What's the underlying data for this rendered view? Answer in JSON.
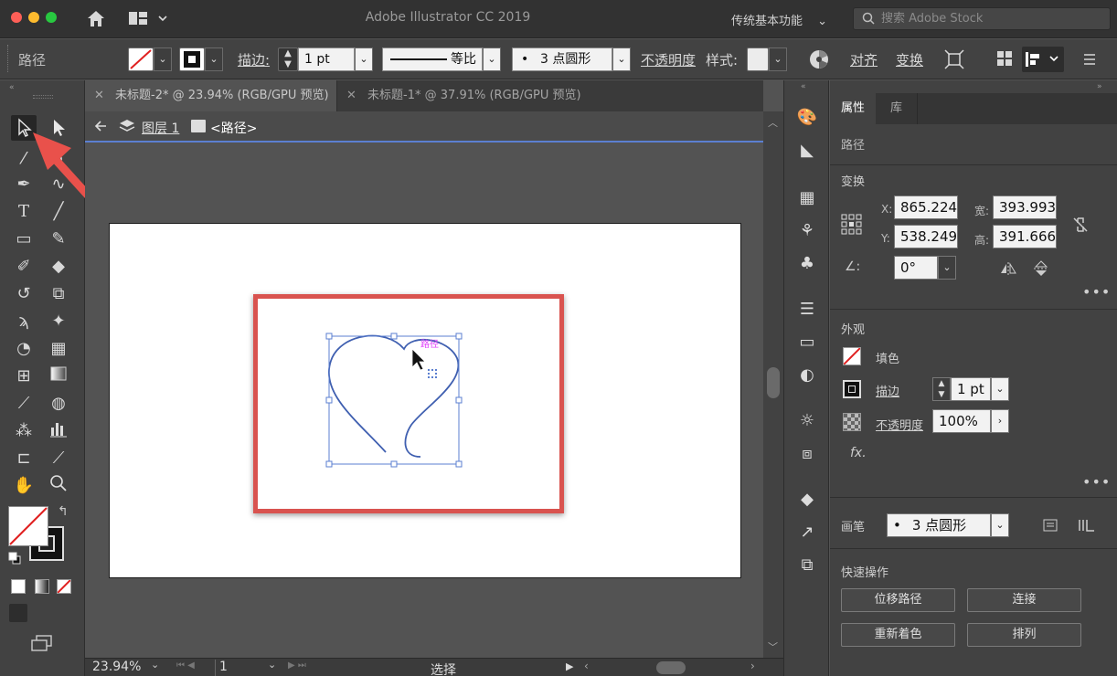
{
  "window": {
    "title": "Adobe Illustrator CC 2019",
    "workspace": "传统基本功能",
    "stock_search_placeholder": "搜索 Adobe Stock"
  },
  "control_bar": {
    "selection_type": "路径",
    "stroke_label": "描边:",
    "stroke_weight": "1 pt",
    "stroke_profile": "等比",
    "brush": "3 点圆形",
    "opacity_label": "不透明度",
    "style_label": "样式:",
    "align_label": "对齐",
    "transform_label": "变换"
  },
  "document_tabs": [
    {
      "label": "未标题-2* @ 23.94% (RGB/GPU 预览)",
      "active": true
    },
    {
      "label": "未标题-1* @ 37.91% (RGB/GPU 预览)",
      "active": false
    }
  ],
  "breadcrumb": {
    "layer": "图层 1",
    "object": "<路径>"
  },
  "canvas": {
    "path_hint": "路径"
  },
  "status_bar": {
    "zoom": "23.94%",
    "artboard_number": "1",
    "tool_status": "选择"
  },
  "properties_panel": {
    "tabs": [
      "属性",
      "库"
    ],
    "selection_label": "路径",
    "transform": {
      "title": "变换",
      "x_label": "X:",
      "x_value": "865.224",
      "y_label": "Y:",
      "y_value": "538.249",
      "w_label": "宽:",
      "w_value": "393.993",
      "h_label": "高:",
      "h_value": "391.666",
      "angle_value": "0°"
    },
    "appearance": {
      "title": "外观",
      "fill_label": "填色",
      "stroke_label": "描边",
      "stroke_value": "1 pt",
      "opacity_label": "不透明度",
      "opacity_value": "100%",
      "fx_label": "fx."
    },
    "brush": {
      "label": "画笔",
      "value": "3 点圆形"
    },
    "quick_actions": {
      "title": "快速操作",
      "buttons": [
        "位移路径",
        "连接",
        "重新着色",
        "排列"
      ]
    }
  },
  "colors": {
    "highlight_box": "#d9534f",
    "selection_blue": "#5b7fd0",
    "path_stroke": "#3f5fb0",
    "path_hint": "#e040fb",
    "annotation_arrow": "#e9514b"
  }
}
